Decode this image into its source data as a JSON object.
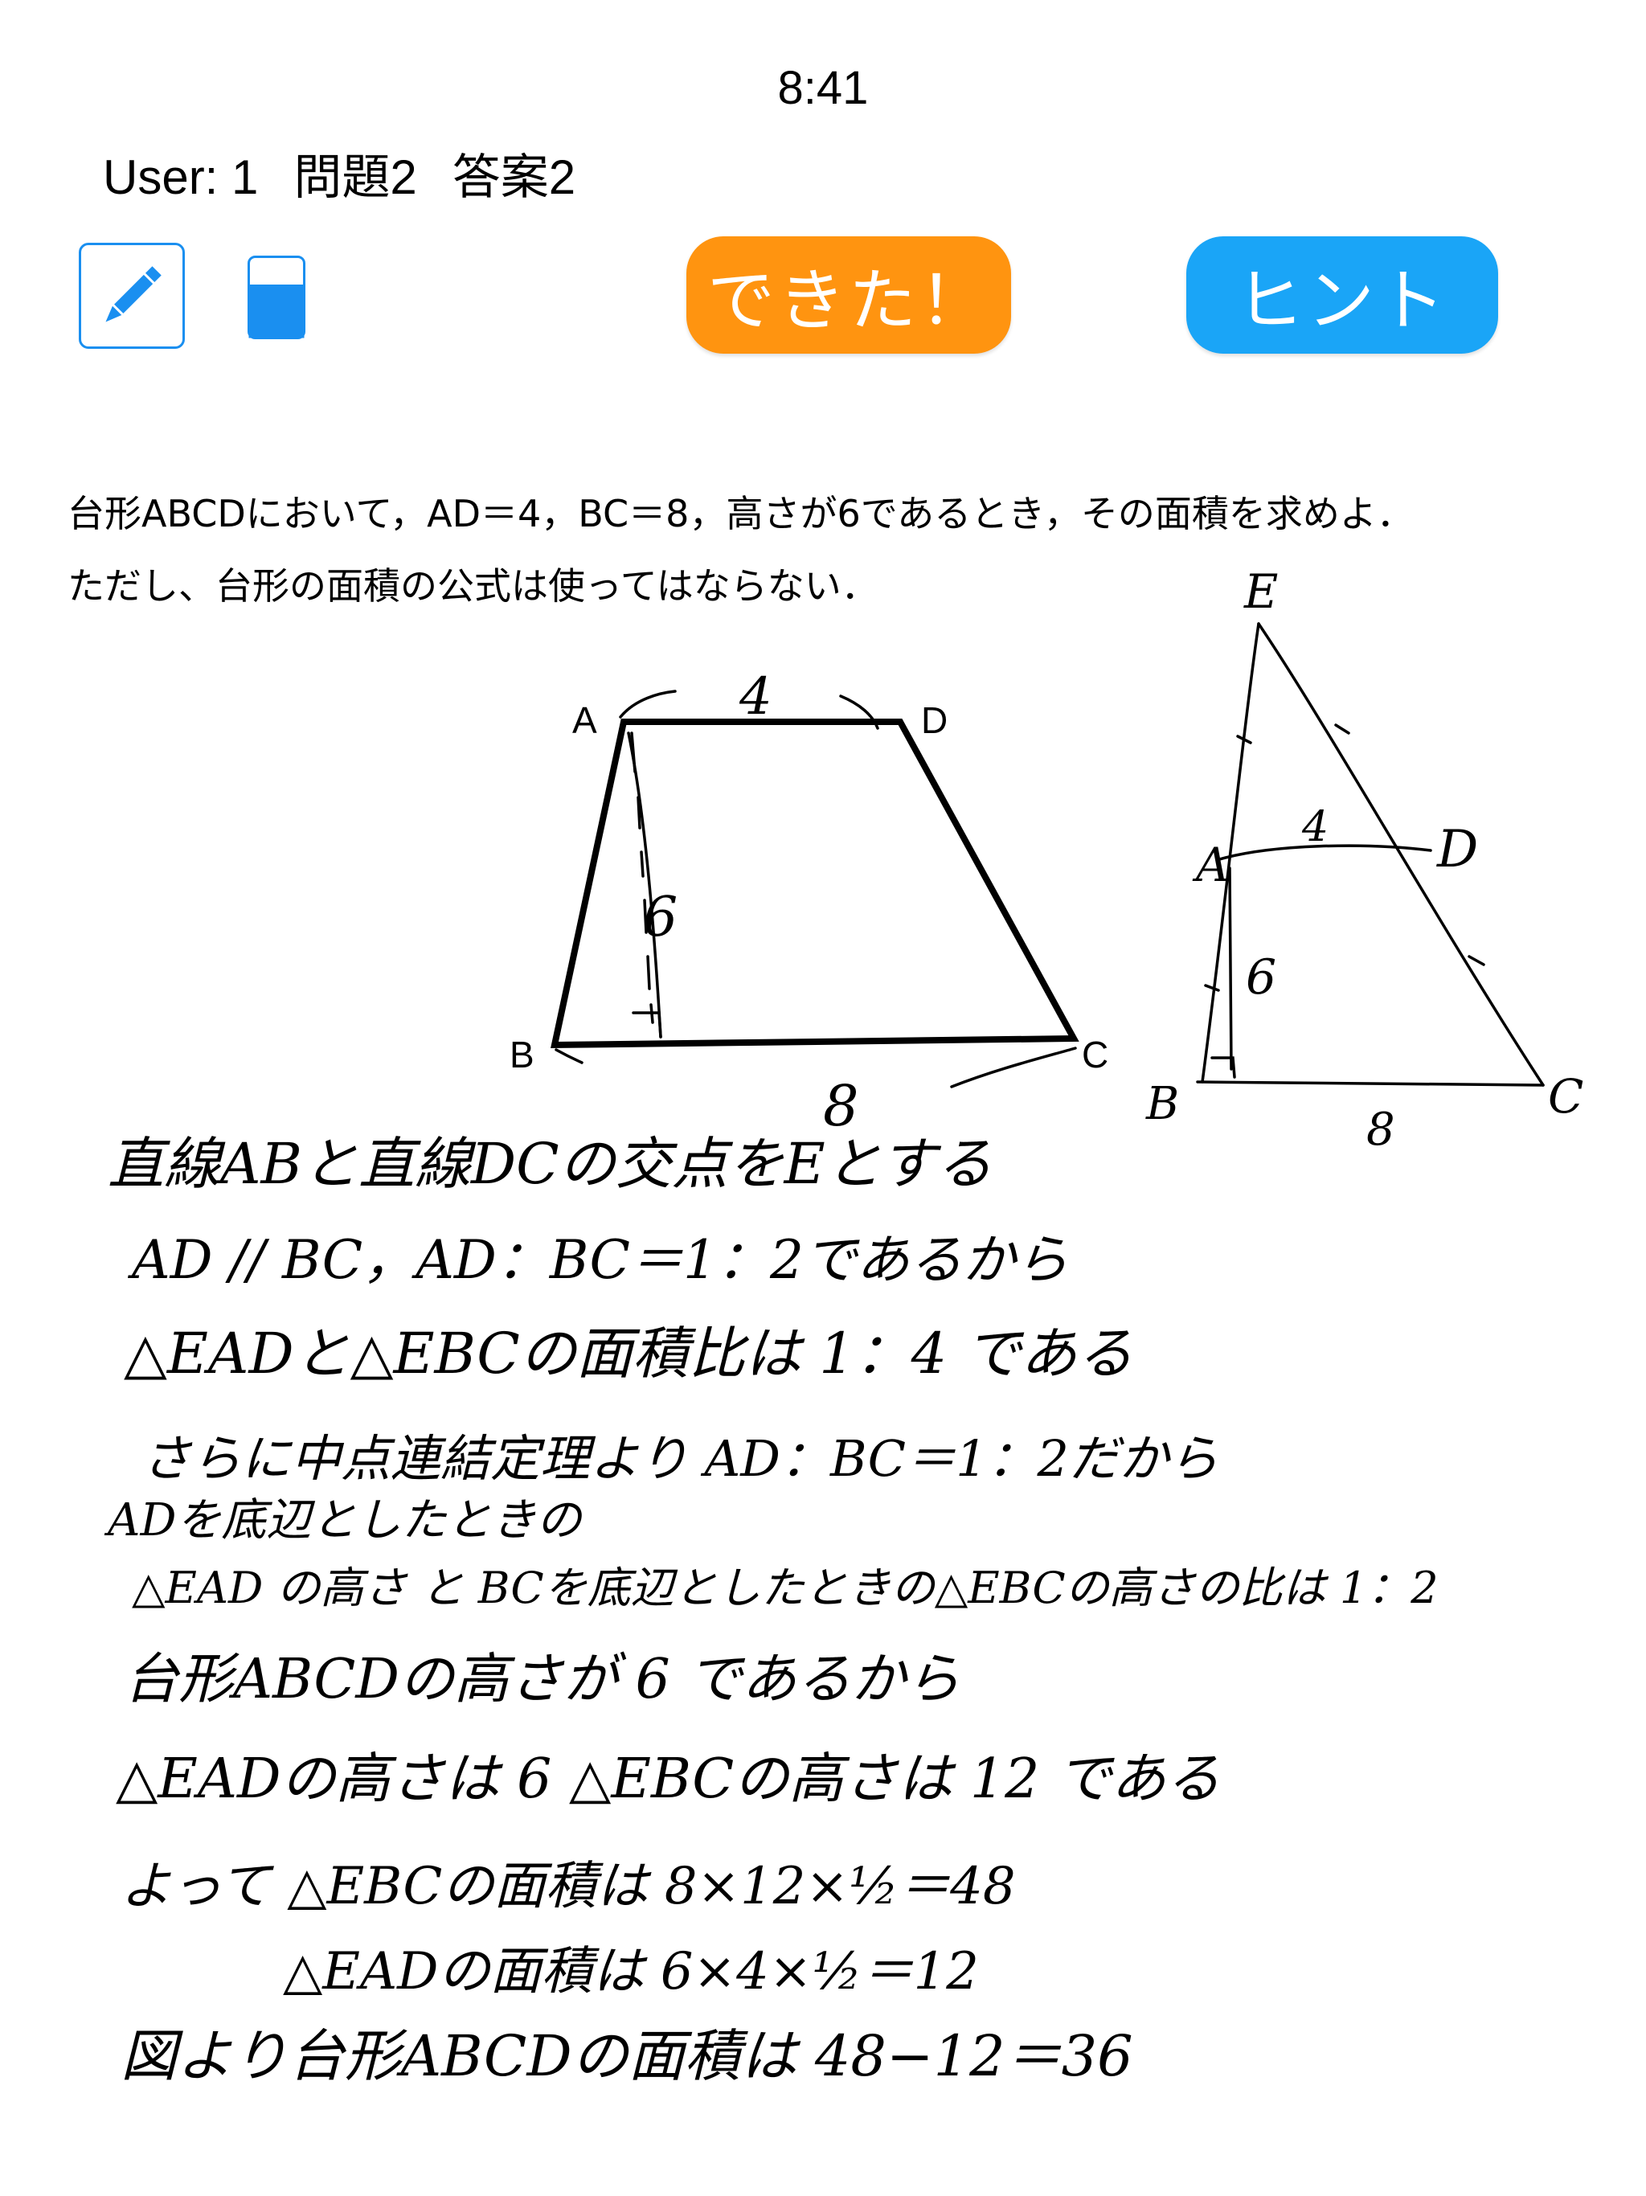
{
  "status": {
    "time": "8:41"
  },
  "header": {
    "user": "User: 1",
    "problem": "問題2",
    "answer": "答案2"
  },
  "toolbar": {
    "pen_icon": "pencil-icon",
    "eraser_icon": "eraser-icon"
  },
  "buttons": {
    "done": "できた！",
    "hint": "ヒント"
  },
  "colors": {
    "accent_blue": "#1a8ff0",
    "done_orange": "#ff9410",
    "hint_blue": "#1aa5f7"
  },
  "problem": {
    "line1": "台形ABCDにおいて，AD＝4，BC＝8，高さが6であるとき，その面積を求めよ．",
    "line2": "ただし、台形の面積の公式は使ってはならない．"
  },
  "figure": {
    "labels": {
      "a": "A",
      "b": "B",
      "c": "C",
      "d": "D"
    }
  },
  "handwriting": {
    "fig_top": "4",
    "fig_height": "6",
    "fig_bottom": "8",
    "fig2_e": "E",
    "fig2_a": "A",
    "fig2_d": "D",
    "fig2_b": "B",
    "fig2_c": "C",
    "fig2_4": "4",
    "fig2_6": "6",
    "fig2_8": "8",
    "lines": [
      "直線ABと直線DCの交点をEとする",
      "AD // BC，AD：BC＝1：2であるから",
      "△EADと△EBCの面積比は 1：4 である",
      "さらに中点連結定理より  AD：BC＝1：2だから",
      "ADを底辺としたときの",
      "△EAD の高さ と  BCを底辺としたときの△EBCの高さの比は 1：2",
      "台形ABCDの高さが 6 であるから",
      "△EADの高さは 6  △EBCの高さは 12 である",
      "よって  △EBCの面積は  8×12×½＝48",
      "△EADの面積は  6×4×½＝12",
      "図より台形ABCDの面積は  48−12＝36"
    ]
  }
}
